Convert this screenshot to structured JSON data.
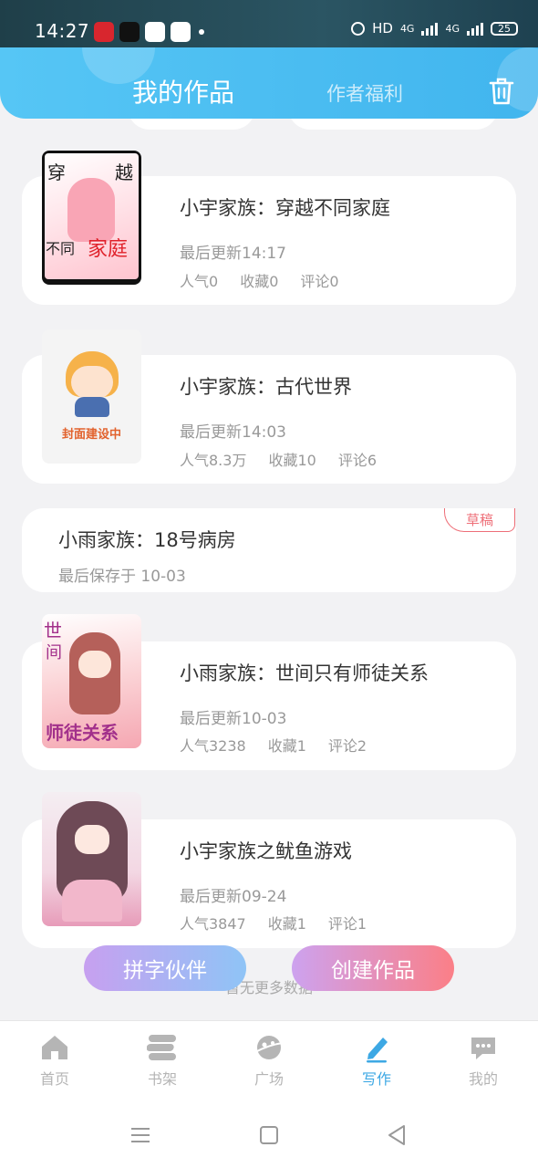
{
  "status_bar": {
    "time": "14:27",
    "hd": "HD",
    "net1": "4G",
    "net2": "4G",
    "battery": "25"
  },
  "header": {
    "tab_active": "我的作品",
    "tab_other": "作者福利",
    "accent": "#41b5ee"
  },
  "works": [
    {
      "title": "小宇家族：穿越不同家庭",
      "updated": "最后更新14:17",
      "popularity": "人气0",
      "favorites": "收藏0",
      "comments": "评论0",
      "cover_text": [
        "穿",
        "越",
        "不同",
        "家庭"
      ]
    },
    {
      "title": "小宇家族：古代世界",
      "updated": "最后更新14:03",
      "popularity": "人气8.3万",
      "favorites": "收藏10",
      "comments": "评论6",
      "cover_text": [
        "封面建设中"
      ]
    },
    {
      "title": "小雨家族：世间只有师徒关系",
      "updated": "最后更新10-03",
      "popularity": "人气3238",
      "favorites": "收藏1",
      "comments": "评论2",
      "cover_text": [
        "世",
        "间",
        "师徒关系"
      ]
    },
    {
      "title": "小宇家族之鱿鱼游戏",
      "updated": "最后更新09-24",
      "popularity": "人气3847",
      "favorites": "收藏1",
      "comments": "评论1"
    }
  ],
  "draft": {
    "title": "小雨家族：18号病房",
    "saved": "最后保存于 10-03",
    "tag": "草稿"
  },
  "no_more": "暂无更多数据",
  "fab": {
    "partner": "拼字伙伴",
    "create": "创建作品"
  },
  "nav": {
    "items": [
      {
        "label": "首页",
        "icon": "home-icon"
      },
      {
        "label": "书架",
        "icon": "bookshelf-icon"
      },
      {
        "label": "广场",
        "icon": "planet-icon"
      },
      {
        "label": "写作",
        "icon": "pen-icon",
        "active": true
      },
      {
        "label": "我的",
        "icon": "chat-bubble-icon"
      }
    ],
    "active_color": "#3da8e4"
  }
}
